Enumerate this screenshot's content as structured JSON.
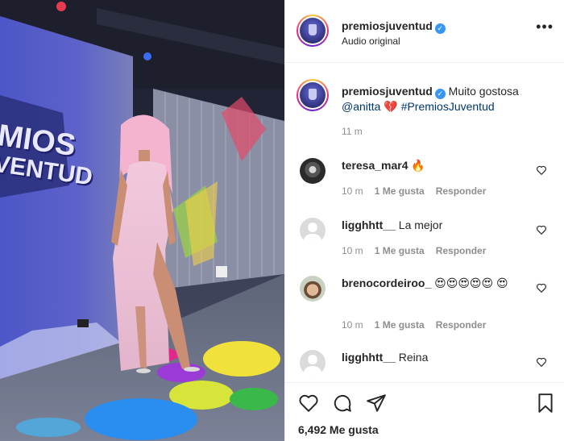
{
  "media": {
    "sign_line1": "MIOS",
    "sign_line2": "VENTUD"
  },
  "header": {
    "username": "premiosjuventud",
    "subtitle": "Audio original",
    "more": "•••"
  },
  "caption": {
    "username": "premiosjuventud",
    "text": " Muito gostosa",
    "mention": "@anitta",
    "emoji": "💔",
    "hashtag": "#PremiosJuventud",
    "time": "11 m"
  },
  "comments": [
    {
      "username": "teresa_mar4",
      "text": " 🔥",
      "time": "10 m",
      "likes": "1 Me gusta",
      "reply": "Responder",
      "avatar": "dark"
    },
    {
      "username": "ligghhtt__",
      "text": " La mejor",
      "time": "10 m",
      "likes": "1 Me gusta",
      "reply": "Responder",
      "avatar": "blank"
    },
    {
      "username": "brenocordeiroo_",
      "text": " 😍😍😍😍😍 😍",
      "time": "10 m",
      "likes": "1 Me gusta",
      "reply": "Responder",
      "avatar": "face"
    },
    {
      "username": "ligghhtt__",
      "text": " Reina",
      "avatar": "blank"
    }
  ],
  "actions": {
    "likes_count": "6,492 Me gusta",
    "icons": [
      "heart-icon",
      "comment-icon",
      "share-icon",
      "bookmark-icon"
    ]
  },
  "colors": {
    "verified": "#3897f0",
    "link": "#00376b",
    "muted": "#8e8e8e"
  }
}
